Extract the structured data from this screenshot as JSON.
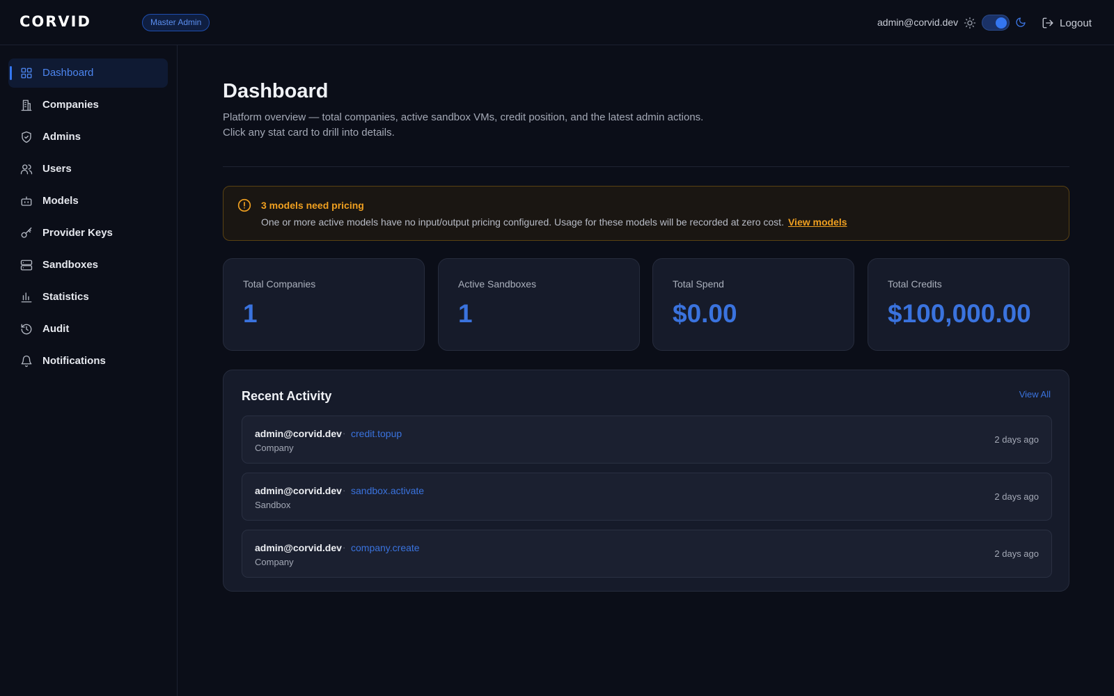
{
  "header": {
    "logo": "CORVID",
    "role_badge": "Master Admin",
    "user_email": "admin@corvid.dev",
    "logout_label": "Logout",
    "theme": "dark"
  },
  "sidebar": {
    "items": [
      {
        "label": "Dashboard",
        "icon": "grid-icon",
        "active": true
      },
      {
        "label": "Companies",
        "icon": "building-icon"
      },
      {
        "label": "Admins",
        "icon": "shield-icon"
      },
      {
        "label": "Users",
        "icon": "users-icon"
      },
      {
        "label": "Models",
        "icon": "bot-icon"
      },
      {
        "label": "Provider Keys",
        "icon": "key-icon"
      },
      {
        "label": "Sandboxes",
        "icon": "server-icon"
      },
      {
        "label": "Statistics",
        "icon": "bar-chart-icon"
      },
      {
        "label": "Audit",
        "icon": "history-icon"
      },
      {
        "label": "Notifications",
        "icon": "bell-icon"
      }
    ]
  },
  "main": {
    "title": "Dashboard",
    "description": "Platform overview — total companies, active sandbox VMs, credit position, and the latest admin actions. Click any stat card to drill into details.",
    "alert": {
      "title": "3 models need pricing",
      "body": "One or more active models have no input/output pricing configured. Usage for these models will be recorded at zero cost.",
      "link": "View models"
    },
    "stats": [
      {
        "label": "Total Companies",
        "value": "1"
      },
      {
        "label": "Active Sandboxes",
        "value": "1"
      },
      {
        "label": "Total Spend",
        "value": "$0.00"
      },
      {
        "label": "Total Credits",
        "value": "$100,000.00"
      }
    ],
    "activity": {
      "title": "Recent Activity",
      "view_all": "View All",
      "separator": "·",
      "rows": [
        {
          "user": "admin@corvid.dev",
          "action": "credit.topup",
          "entity": "Company",
          "time": "2 days ago"
        },
        {
          "user": "admin@corvid.dev",
          "action": "sandbox.activate",
          "entity": "Sandbox",
          "time": "2 days ago"
        },
        {
          "user": "admin@corvid.dev",
          "action": "company.create",
          "entity": "Company",
          "time": "2 days ago"
        }
      ]
    }
  },
  "colors": {
    "background": "#0b0e18",
    "accent": "#3a73de",
    "warning": "#f0a020",
    "card": "#161b2a"
  }
}
